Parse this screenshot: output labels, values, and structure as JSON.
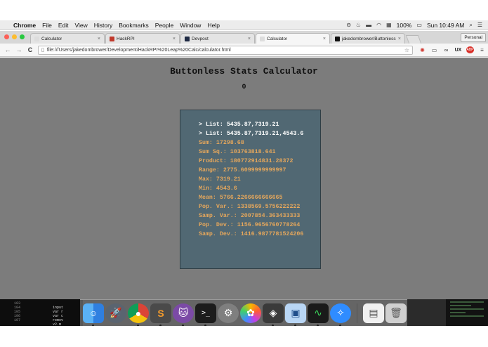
{
  "menubar": {
    "app": "Chrome",
    "items": [
      "File",
      "Edit",
      "View",
      "History",
      "Bookmarks",
      "People",
      "Window",
      "Help"
    ],
    "battery": "100%",
    "clock": "Sun 10:49 AM"
  },
  "tabs": [
    {
      "label": "Calculator",
      "favicon_color": "#dddddd"
    },
    {
      "label": "HackRPI",
      "favicon_color": "#c0392b"
    },
    {
      "label": "Devpost",
      "favicon_color": "#1f2a44"
    },
    {
      "label": "Calculator",
      "favicon_color": "#dddddd"
    },
    {
      "label": "jakedombrower/Buttonless",
      "favicon_color": "#111111"
    }
  ],
  "profile_label": "Personal",
  "address_bar": {
    "url": "file:///Users/jakedombrower/Development/HackRPI%20Leap%20Calc/calculator.html"
  },
  "page": {
    "title": "Buttonless Stats Calculator",
    "display_value": "0",
    "lines": [
      {
        "kind": "cmd",
        "text": "> List: 5435.87,7319.21"
      },
      {
        "kind": "cmd",
        "text": "> List: 5435.87,7319.21,4543.6"
      },
      {
        "kind": "res",
        "text": "Sum: 17298.68"
      },
      {
        "kind": "res",
        "text": "Sum Sq.: 103763818.641"
      },
      {
        "kind": "res",
        "text": "Product: 180772914831.28372"
      },
      {
        "kind": "res",
        "text": "Range: 2775.6099999999997"
      },
      {
        "kind": "res",
        "text": "Max: 7319.21"
      },
      {
        "kind": "res",
        "text": "Min: 4543.6"
      },
      {
        "kind": "res",
        "text": "Mean: 5766.2266666666665"
      },
      {
        "kind": "res",
        "text": "Pop. Var.: 1338569.5756222222"
      },
      {
        "kind": "res",
        "text": "Samp. Var.: 2007854.363433333"
      },
      {
        "kind": "res",
        "text": "Pop. Dev.: 1156.9656760778264"
      },
      {
        "kind": "res",
        "text": "Samp. Dev.: 1416.9877781524206"
      }
    ]
  },
  "terminal": {
    "line_numbers": [
      "103",
      "104",
      "105",
      "106",
      "107"
    ],
    "code": [
      "input",
      "var r",
      "var c",
      "remov",
      "v2.m"
    ]
  },
  "dock": [
    {
      "name": "finder-icon",
      "glyph": "☺",
      "cls": "ic-finder",
      "running": true
    },
    {
      "name": "launchpad-icon",
      "glyph": "🚀",
      "cls": "ic-rocket",
      "running": false
    },
    {
      "name": "chrome-icon",
      "glyph": "●",
      "cls": "ic-chrome",
      "running": true
    },
    {
      "name": "sublime-text-icon",
      "glyph": "S",
      "cls": "ic-sublime",
      "running": true
    },
    {
      "name": "github-desktop-icon",
      "glyph": "🐱",
      "cls": "ic-github",
      "running": true
    },
    {
      "name": "terminal-icon",
      "glyph": ">_",
      "cls": "ic-term",
      "running": true
    },
    {
      "name": "system-preferences-icon",
      "glyph": "⚙",
      "cls": "ic-prefs",
      "running": false
    },
    {
      "name": "photos-icon",
      "glyph": "✿",
      "cls": "ic-photos",
      "running": false
    },
    {
      "name": "app-store-icon",
      "glyph": "◈",
      "cls": "ic-store",
      "running": true
    },
    {
      "name": "virtualbox-icon",
      "glyph": "▣",
      "cls": "ic-vbox",
      "running": true
    },
    {
      "name": "activity-monitor-icon",
      "glyph": "∿",
      "cls": "ic-activity",
      "running": true
    },
    {
      "name": "safari-icon",
      "glyph": "✧",
      "cls": "ic-safari",
      "running": true
    }
  ],
  "dock_right": [
    {
      "name": "document-icon",
      "glyph": "▤",
      "cls": "ic-doc"
    },
    {
      "name": "trash-icon",
      "glyph": "🗑",
      "cls": "ic-trash"
    }
  ]
}
